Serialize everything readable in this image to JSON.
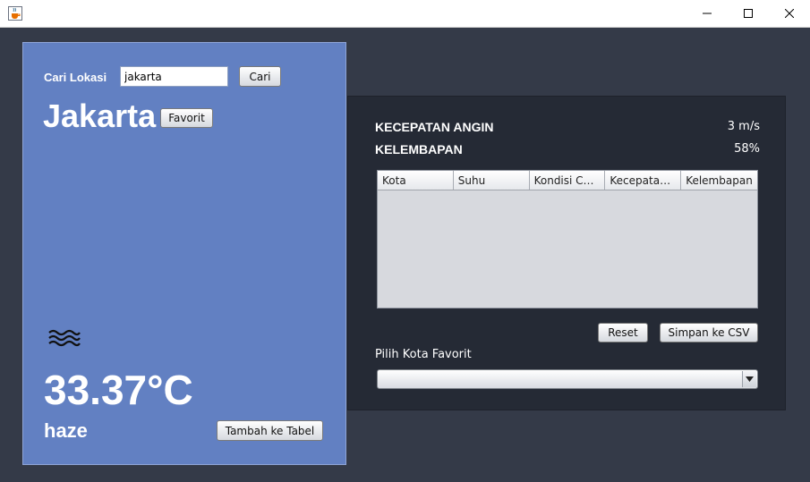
{
  "window": {
    "app_icon": "java-cup-icon",
    "controls": [
      "minimize-icon",
      "maximize-icon",
      "close-icon"
    ]
  },
  "search": {
    "label": "Cari Lokasi",
    "value": "jakarta",
    "button": "Cari"
  },
  "city": {
    "name": "Jakarta",
    "favorite_button": "Favorit"
  },
  "weather": {
    "icon": "haze-icon",
    "temperature": "33.37°C",
    "condition": "haze",
    "add_button": "Tambah ke Tabel"
  },
  "stats": {
    "wind_label": "KECEPATAN ANGIN",
    "wind_value": "3 m/s",
    "humidity_label": "KELEMBAPAN",
    "humidity_value": "58%"
  },
  "table": {
    "columns": [
      "Kota",
      "Suhu",
      "Kondisi Cuaca",
      "Kecepatan Angin",
      "Kelembapan"
    ],
    "rows": []
  },
  "actions": {
    "reset": "Reset",
    "save_csv": "Simpan ke CSV"
  },
  "favorites": {
    "label": "Pilih Kota Favorit",
    "selected": ""
  },
  "colors": {
    "background": "#343a48",
    "left_panel": "#6280c2",
    "right_panel": "#252a35"
  }
}
